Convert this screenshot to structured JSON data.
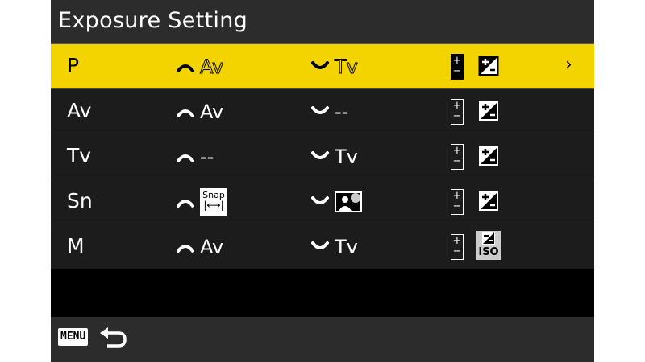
{
  "title": "Exposure Setting",
  "rows": [
    {
      "mode": "P",
      "front": "Av",
      "rear": "Tv",
      "pm_plus": "+",
      "pm_minus": "−",
      "right_icon": "exposure-compensation-icon",
      "selected": true
    },
    {
      "mode": "Av",
      "front": "Av",
      "rear": "--",
      "pm_plus": "+",
      "pm_minus": "−",
      "right_icon": "exposure-compensation-icon",
      "selected": false
    },
    {
      "mode": "Tv",
      "front": "--",
      "rear": "Tv",
      "pm_plus": "+",
      "pm_minus": "−",
      "right_icon": "exposure-compensation-icon",
      "selected": false
    },
    {
      "mode": "Sn",
      "front_icon": "snap-focus-distance-icon",
      "front_snap_label": "Snap",
      "front_snap_sub": "|⟷|",
      "rear_icon": "scene-exposure-icon",
      "pm_plus": "+",
      "pm_minus": "−",
      "right_icon": "exposure-compensation-icon",
      "selected": false
    },
    {
      "mode": "M",
      "front": "Av",
      "rear": "Tv",
      "pm_plus": "+",
      "pm_minus": "−",
      "right_icon": "iso-exposure-icon",
      "right_icon_label": "ISO",
      "selected": false
    }
  ],
  "selected_chevron": "›",
  "bottom": {
    "menu_label": "MENU",
    "back_icon": "back-arrow-icon"
  },
  "colors": {
    "highlight": "#f4d400",
    "row_bg": "#1c1c1c",
    "bar_bg": "#2c2c2c"
  }
}
